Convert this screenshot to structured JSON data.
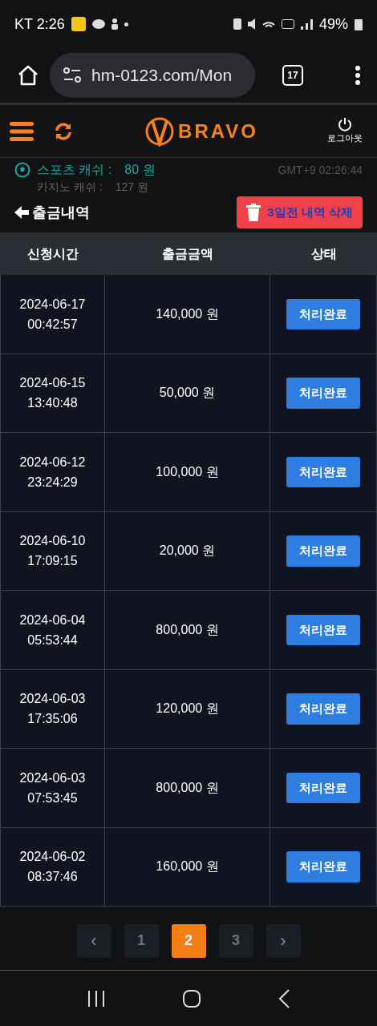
{
  "status_bar": {
    "carrier_time": "KT 2:26",
    "battery": "49%"
  },
  "browser": {
    "url": "hm-0123.com/Mon",
    "tab_count": "17"
  },
  "header": {
    "brand": "BRAVO",
    "logout": "로그아웃"
  },
  "wallet": {
    "sports_label": "스포츠 캐쉬 :",
    "sports_value": "80 원",
    "casino_label": "카지노 캐쉬 :",
    "casino_value": "127 원",
    "clock": "GMT+9 02:26:44"
  },
  "page": {
    "title": "출금내역",
    "delete_button": "3일전 내역 삭제"
  },
  "table": {
    "columns": [
      "신청시간",
      "출금금액",
      "상태"
    ],
    "rows": [
      {
        "date": "2024-06-17",
        "time": "00:42:57",
        "amount": "140,000 원",
        "status": "처리완료"
      },
      {
        "date": "2024-06-15",
        "time": "13:40:48",
        "amount": "50,000 원",
        "status": "처리완료"
      },
      {
        "date": "2024-06-12",
        "time": "23:24:29",
        "amount": "100,000 원",
        "status": "처리완료"
      },
      {
        "date": "2024-06-10",
        "time": "17:09:15",
        "amount": "20,000 원",
        "status": "처리완료"
      },
      {
        "date": "2024-06-04",
        "time": "05:53:44",
        "amount": "800,000 원",
        "status": "처리완료"
      },
      {
        "date": "2024-06-03",
        "time": "17:35:06",
        "amount": "120,000 원",
        "status": "처리완료"
      },
      {
        "date": "2024-06-03",
        "time": "07:53:45",
        "amount": "800,000 원",
        "status": "처리완료"
      },
      {
        "date": "2024-06-02",
        "time": "08:37:46",
        "amount": "160,000 원",
        "status": "처리완료"
      }
    ]
  },
  "pagination": {
    "prev": "‹",
    "next": "›",
    "pages": [
      {
        "label": "1",
        "selected": false
      },
      {
        "label": "2",
        "selected": true
      },
      {
        "label": "3",
        "selected": false
      }
    ]
  }
}
